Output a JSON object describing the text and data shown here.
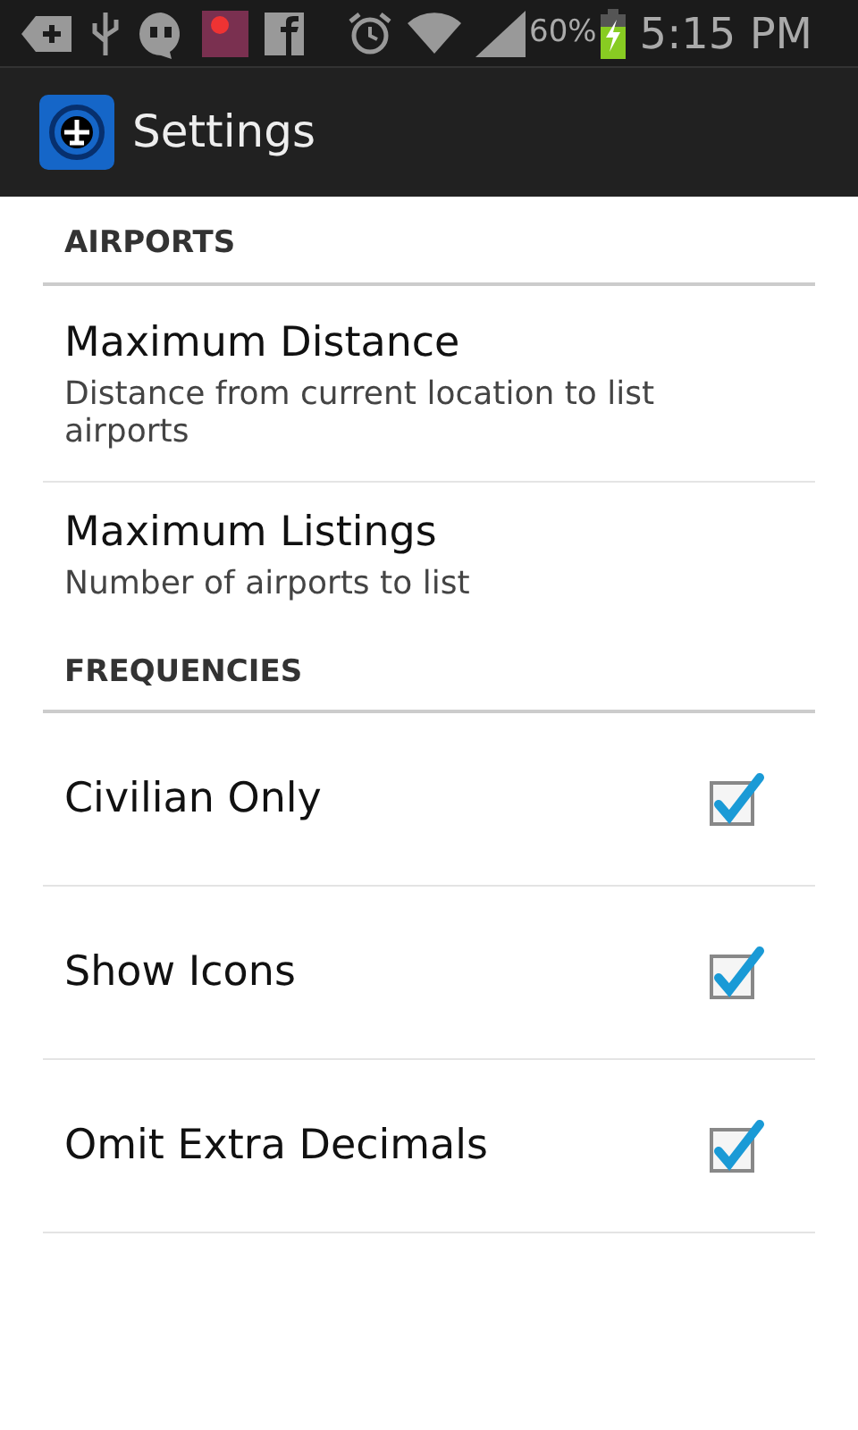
{
  "status_bar": {
    "battery": "60%",
    "time": "5:15 PM"
  },
  "action_bar": {
    "title": "Settings"
  },
  "sections": [
    {
      "title": "AIRPORTS",
      "items": [
        {
          "kind": "text",
          "title": "Maximum Distance",
          "summary": "Distance from current location to list airports"
        },
        {
          "kind": "text",
          "title": "Maximum Listings",
          "summary": "Number of airports to list"
        }
      ]
    },
    {
      "title": "FREQUENCIES",
      "items": [
        {
          "kind": "checkbox",
          "title": "Civilian Only",
          "checked": true
        },
        {
          "kind": "checkbox",
          "title": "Show Icons",
          "checked": true
        },
        {
          "kind": "checkbox",
          "title": "Omit Extra Decimals",
          "checked": true
        }
      ]
    }
  ]
}
